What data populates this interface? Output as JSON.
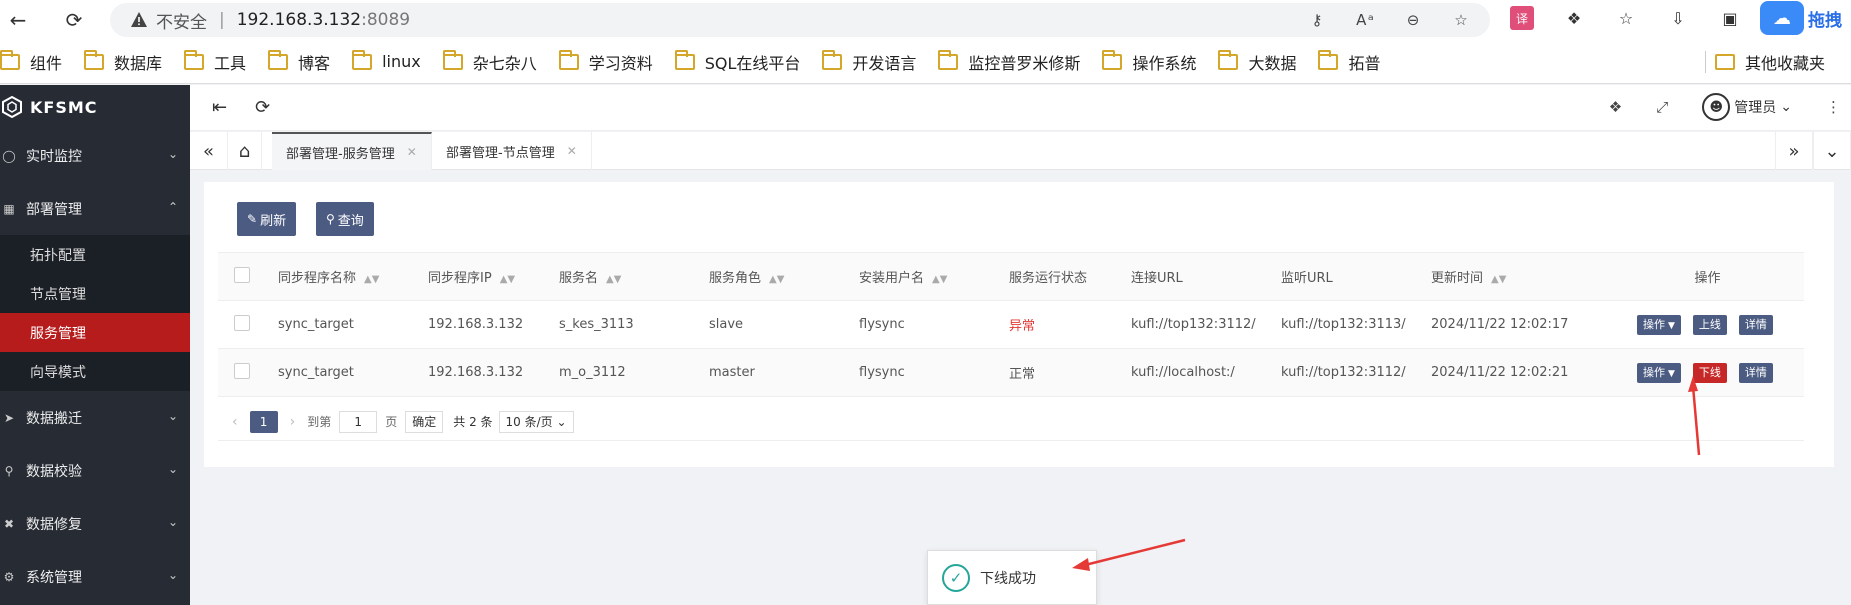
{
  "browser": {
    "insecure_label": "不安全",
    "host": "192.168.3.132",
    "port": ":8089",
    "extension_label": "拖拽"
  },
  "bookmarks": [
    "组件",
    "数据库",
    "工具",
    "博客",
    "linux",
    "杂七杂八",
    "学习资料",
    "SQL在线平台",
    "开发语言",
    "监控普罗米修斯",
    "操作系统",
    "大数据",
    "拓普"
  ],
  "bookmarks_other": "其他收藏夹",
  "app": {
    "name": "KFSMC",
    "user": "管理员"
  },
  "sidebar": {
    "items": [
      {
        "label": "实时监控",
        "icon": "monitor-icon"
      },
      {
        "label": "部署管理",
        "icon": "deploy-icon"
      },
      {
        "label": "数据搬迁",
        "icon": "migrate-icon"
      },
      {
        "label": "数据校验",
        "icon": "verify-icon"
      },
      {
        "label": "数据修复",
        "icon": "repair-icon"
      },
      {
        "label": "系统管理",
        "icon": "system-icon"
      }
    ],
    "submenu": [
      "拓扑配置",
      "节点管理",
      "服务管理",
      "向导模式"
    ]
  },
  "tabs": [
    "部署管理-服务管理",
    "部署管理-节点管理"
  ],
  "toolbar": {
    "refresh_label": "刷新",
    "query_label": "查询"
  },
  "table": {
    "headers": [
      "同步程序名称",
      "同步程序IP",
      "服务名",
      "服务角色",
      "安装用户名",
      "服务运行状态",
      "连接URL",
      "监听URL",
      "更新时间",
      "操作"
    ],
    "rows": [
      {
        "name": "sync_target",
        "ip": "192.168.3.132",
        "service": "s_kes_3113",
        "role": "slave",
        "user": "flysync",
        "status": "异常",
        "conn_url": "kufl://top132:3112/",
        "listen_url": "kufl://top132:3113/",
        "updated": "2024/11/22 12:02:17",
        "op1": "操作",
        "op2": "上线",
        "op3": "详情"
      },
      {
        "name": "sync_target",
        "ip": "192.168.3.132",
        "service": "m_o_3112",
        "role": "master",
        "user": "flysync",
        "status": "正常",
        "conn_url": "kufl://localhost:/",
        "listen_url": "kufl://top132:3112/",
        "updated": "2024/11/22 12:02:21",
        "op1": "操作",
        "op2": "下线",
        "op3": "详情"
      }
    ]
  },
  "pager": {
    "page": "1",
    "goto_label": "到第",
    "goto_value": "1",
    "page_unit": "页",
    "confirm_label": "确定",
    "total_label": "共 2 条",
    "size_label": "10 条/页"
  },
  "toast": {
    "message": "下线成功"
  },
  "colors": {
    "sidebar_bg": "#262b34",
    "active_red": "#b71c1c",
    "button_blue": "#4b5b82",
    "status_error": "#e53935",
    "success_teal": "#26a69a"
  }
}
